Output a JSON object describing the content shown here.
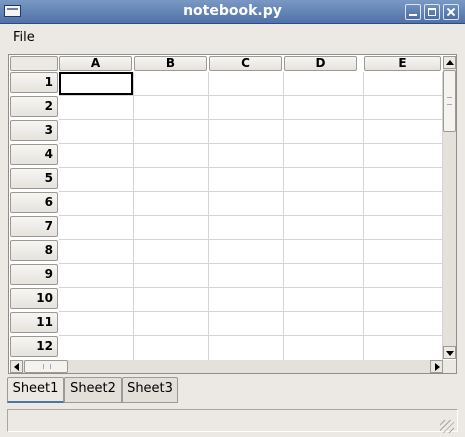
{
  "window": {
    "title": "notebook.py"
  },
  "menu": {
    "items": [
      "File"
    ]
  },
  "grid": {
    "columns": [
      "A",
      "B",
      "C",
      "D",
      "E"
    ],
    "rows": [
      "1",
      "2",
      "3",
      "4",
      "5",
      "6",
      "7",
      "8",
      "9",
      "10",
      "11",
      "12"
    ]
  },
  "tabs": [
    {
      "label": "Sheet1",
      "active": true
    },
    {
      "label": "Sheet2",
      "active": false
    },
    {
      "label": "Sheet3",
      "active": false
    }
  ],
  "icons": {
    "window_menu": "window-menu-icon",
    "minimize": "minimize-icon",
    "maximize": "maximize-icon",
    "close": "close-icon",
    "scroll_up": "arrow-up-icon",
    "scroll_down": "arrow-down-icon",
    "scroll_left": "arrow-left-icon",
    "scroll_right": "arrow-right-icon",
    "resize_grip": "resize-grip-icon"
  },
  "colors": {
    "titlebar": "#5b7db2",
    "accent": "#4f72a8"
  }
}
